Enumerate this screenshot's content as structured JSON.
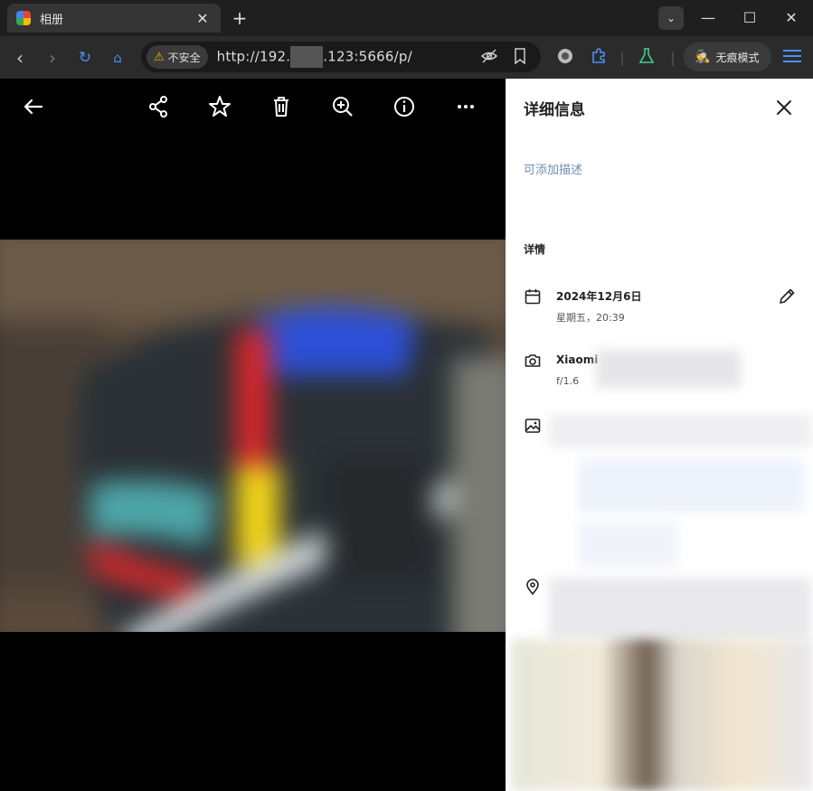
{
  "browser": {
    "tab_title": "相册",
    "tab_close": "✕",
    "new_tab": "+",
    "security_label": "不安全",
    "url_start": "http://192.",
    "url_end": ".123:5666/p/",
    "incognito_label": "无痕模式"
  },
  "panel": {
    "title": "详细信息",
    "description_placeholder": "可添加描述",
    "section_title": "详情",
    "date": "2024年12月6日",
    "day_time": "星期五，20:39",
    "camera_model": "Xiaomi",
    "aperture": "f/1.6"
  },
  "icons": {
    "back": "arrow-left-icon",
    "share": "share-icon",
    "favorite": "star-icon",
    "delete": "trash-icon",
    "zoom": "zoom-in-icon",
    "info": "info-icon",
    "more": "more-icon"
  },
  "colors": {
    "accent": "#4d8ef7",
    "description_link": "#6f8db3"
  }
}
